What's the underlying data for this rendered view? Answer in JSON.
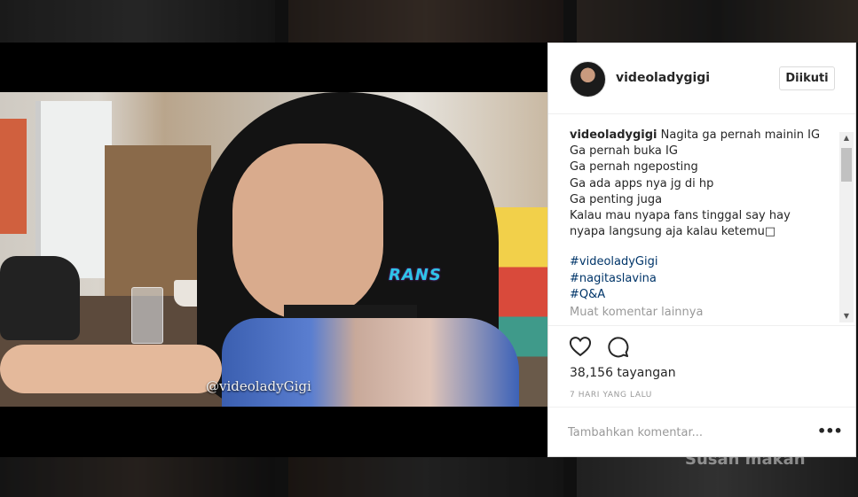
{
  "post": {
    "username": "videoladygigi",
    "follow_label": "Diikuti",
    "caption_user": "videoladygigi",
    "caption_lines": [
      "Nagita ga pernah mainin IG",
      "Ga pernah buka IG",
      "Ga pernah ngeposting",
      "Ga ada apps nya jg di hp",
      "Ga penting juga",
      "Kalau mau nyapa fans tinggal say hay",
      "nyapa langsung aja kalau ketemu□"
    ],
    "hashtags": [
      "#videoladyGigi",
      "#nagitaslavina",
      "#Q&A"
    ],
    "load_more": "Muat komentar lainnya",
    "views": "38,156 tayangan",
    "time_ago": "7 HARI YANG LALU",
    "comment_placeholder": "Tambahkan komentar...",
    "options": "•••"
  },
  "video": {
    "watermark_center": "RANS",
    "watermark_bottom": "@videoladyGigi"
  },
  "background": {
    "bottom_text": "Susan makan"
  },
  "icons": {
    "like": "heart-icon",
    "comment": "speech-bubble-icon",
    "options": "more-horizontal-icon"
  },
  "colors": {
    "hashtag": "#003569",
    "text": "#262626",
    "muted": "#999999"
  }
}
